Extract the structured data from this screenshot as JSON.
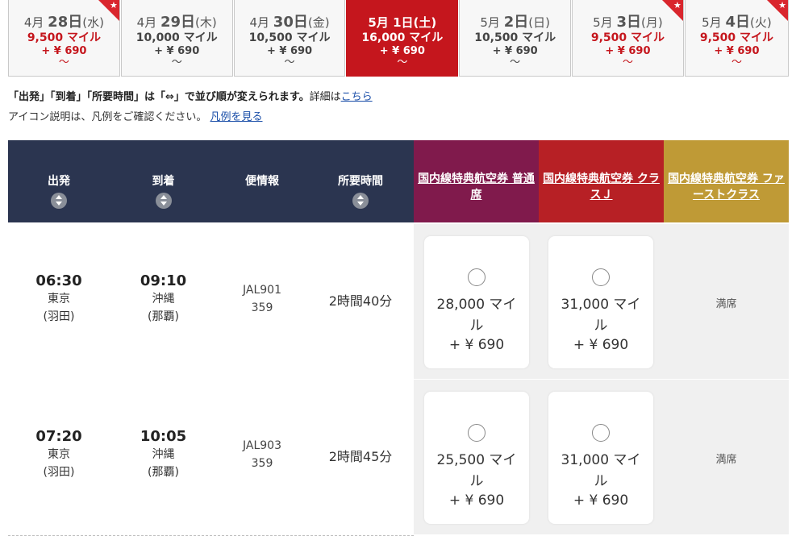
{
  "dates": [
    {
      "month": "4月",
      "day": "28日",
      "dow": "(水)",
      "miles": "9,500 マイル",
      "tax": "+ ¥ 690",
      "tilde": "〜",
      "style": "red",
      "star": true
    },
    {
      "month": "4月",
      "day": "29日",
      "dow": "(木)",
      "miles": "10,000 マイル",
      "tax": "+ ¥ 690",
      "tilde": "〜",
      "style": "gray",
      "star": false
    },
    {
      "month": "4月",
      "day": "30日",
      "dow": "(金)",
      "miles": "10,500 マイル",
      "tax": "+ ¥ 690",
      "tilde": "〜",
      "style": "gray",
      "star": false
    },
    {
      "month": "5月",
      "day": "1日",
      "dow": "(土)",
      "miles": "16,000 マイル",
      "tax": "+ ¥ 690",
      "tilde": "〜",
      "style": "selected",
      "star": false
    },
    {
      "month": "5月",
      "day": "2日",
      "dow": "(日)",
      "miles": "10,500 マイル",
      "tax": "+ ¥ 690",
      "tilde": "〜",
      "style": "gray",
      "star": false
    },
    {
      "month": "5月",
      "day": "3日",
      "dow": "(月)",
      "miles": "9,500 マイル",
      "tax": "+ ¥ 690",
      "tilde": "〜",
      "style": "red",
      "star": true
    },
    {
      "month": "5月",
      "day": "4日",
      "dow": "(火)",
      "miles": "9,500 マイル",
      "tax": "+ ¥ 690",
      "tilde": "〜",
      "style": "red",
      "star": true
    }
  ],
  "notes": {
    "line1_bold": "「出発」「到着」「所要時間」は「⇔」で並び順が変えられます。",
    "line1_text": "詳細は",
    "line1_link": "こちら",
    "line2_text": "アイコン説明は、凡例をご確認ください。",
    "line2_link": "凡例を見る"
  },
  "headers": {
    "depart": "出発",
    "arrive": "到着",
    "flight": "便情報",
    "duration": "所要時間",
    "fare1": "国内線特典航空券 普通席",
    "fare2": "国内線特典航空券 クラスＪ",
    "fare3": "国内線特典航空券 ファーストクラス"
  },
  "flights": [
    {
      "dep_time": "06:30",
      "dep_city": "東京",
      "dep_airport": "(羽田)",
      "arr_time": "09:10",
      "arr_city": "沖縄",
      "arr_airport": "(那覇)",
      "flight_no": "JAL901",
      "aircraft": "359",
      "duration": "2時間40分",
      "fare1_miles_a": "28,000 マイ",
      "fare1_miles_b": "ル",
      "fare1_tax": "+ ¥ 690",
      "fare2_miles_a": "31,000 マイ",
      "fare2_miles_b": "ル",
      "fare2_tax": "+ ¥ 690",
      "fare3_status": "満席"
    },
    {
      "dep_time": "07:20",
      "dep_city": "東京",
      "dep_airport": "(羽田)",
      "arr_time": "10:05",
      "arr_city": "沖縄",
      "arr_airport": "(那覇)",
      "flight_no": "JAL903",
      "aircraft": "359",
      "duration": "2時間45分",
      "fare1_miles_a": "25,500 マイ",
      "fare1_miles_b": "ル",
      "fare1_tax": "+ ¥ 690",
      "fare2_miles_a": "31,000 マイ",
      "fare2_miles_b": "ル",
      "fare2_tax": "+ ¥ 690",
      "fare3_status": "満席"
    }
  ],
  "colors": {
    "selected_tab": "#c5161d",
    "header_navy": "#2b3550",
    "fare1_header": "#801a4c",
    "fare2_header": "#b72025",
    "fare3_header": "#bf9a36",
    "link": "#1a4ea8"
  },
  "icons": {
    "sort": "sort-updown-icon",
    "star": "star-icon",
    "radio": "radio-button"
  }
}
